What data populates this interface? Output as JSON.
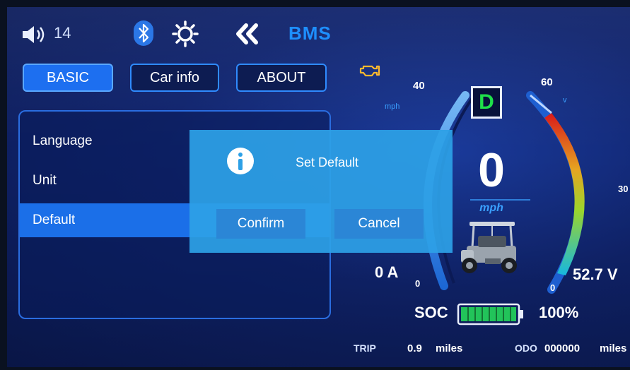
{
  "status_bar": {
    "volume_level": "14",
    "title": "BMS",
    "icons": [
      "speaker-icon",
      "bluetooth-icon",
      "brightness-icon",
      "back-icon"
    ]
  },
  "tabs": [
    {
      "label": "BASIC",
      "active": true
    },
    {
      "label": "Car info",
      "active": false
    },
    {
      "label": "ABOUT",
      "active": false
    }
  ],
  "settings_menu": {
    "items": [
      {
        "label": "Language",
        "selected": false
      },
      {
        "label": "Unit",
        "selected": false
      },
      {
        "label": "Default",
        "selected": true
      }
    ]
  },
  "dashboard": {
    "gear": "D",
    "speed": "0",
    "speed_unit": "mph",
    "speed_gauge": {
      "max_label": "40",
      "min_label": "0",
      "unit": "mph"
    },
    "voltage_gauge": {
      "max_label": "60",
      "mid_label": "30",
      "min_label": "0",
      "unit": "v"
    },
    "current": "0 A",
    "voltage": "52.7 V",
    "soc_label": "SOC",
    "soc_value": "100%",
    "soc_fraction": 1.0,
    "trip_label": "TRIP",
    "trip_value": "0.9",
    "trip_unit": "miles",
    "odo_label": "ODO",
    "odo_value": "000000",
    "odo_unit": "miles"
  },
  "dialog": {
    "message": "Set Default",
    "confirm_label": "Confirm",
    "cancel_label": "Cancel"
  },
  "colors": {
    "accent": "#1e8fff",
    "gear": "#1fe04a",
    "dialog_bg": "#2da0e6"
  }
}
